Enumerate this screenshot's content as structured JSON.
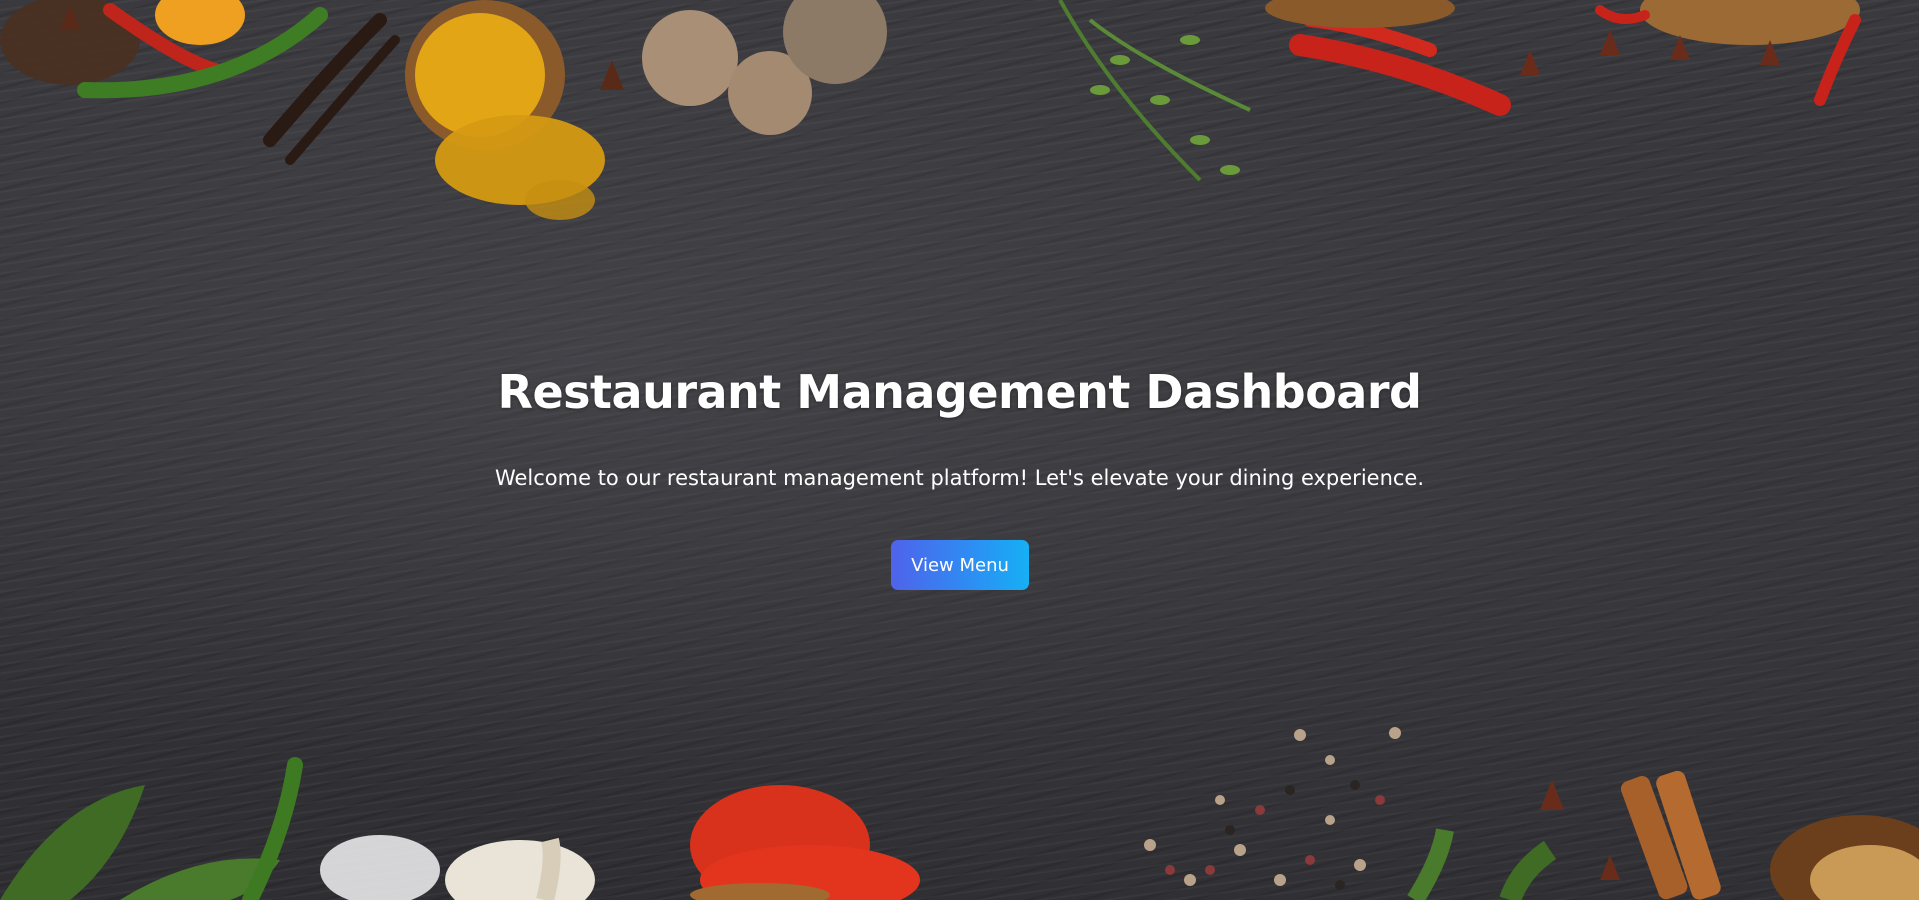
{
  "hero": {
    "title": "Restaurant Management Dashboard",
    "subtitle": "Welcome to our restaurant management platform! Let's elevate your dining experience.",
    "cta_label": "View Menu"
  },
  "colors": {
    "background": "#353539",
    "text": "#ffffff",
    "button_gradient_start": "#4f63ea",
    "button_gradient_end": "#16b0f5"
  }
}
